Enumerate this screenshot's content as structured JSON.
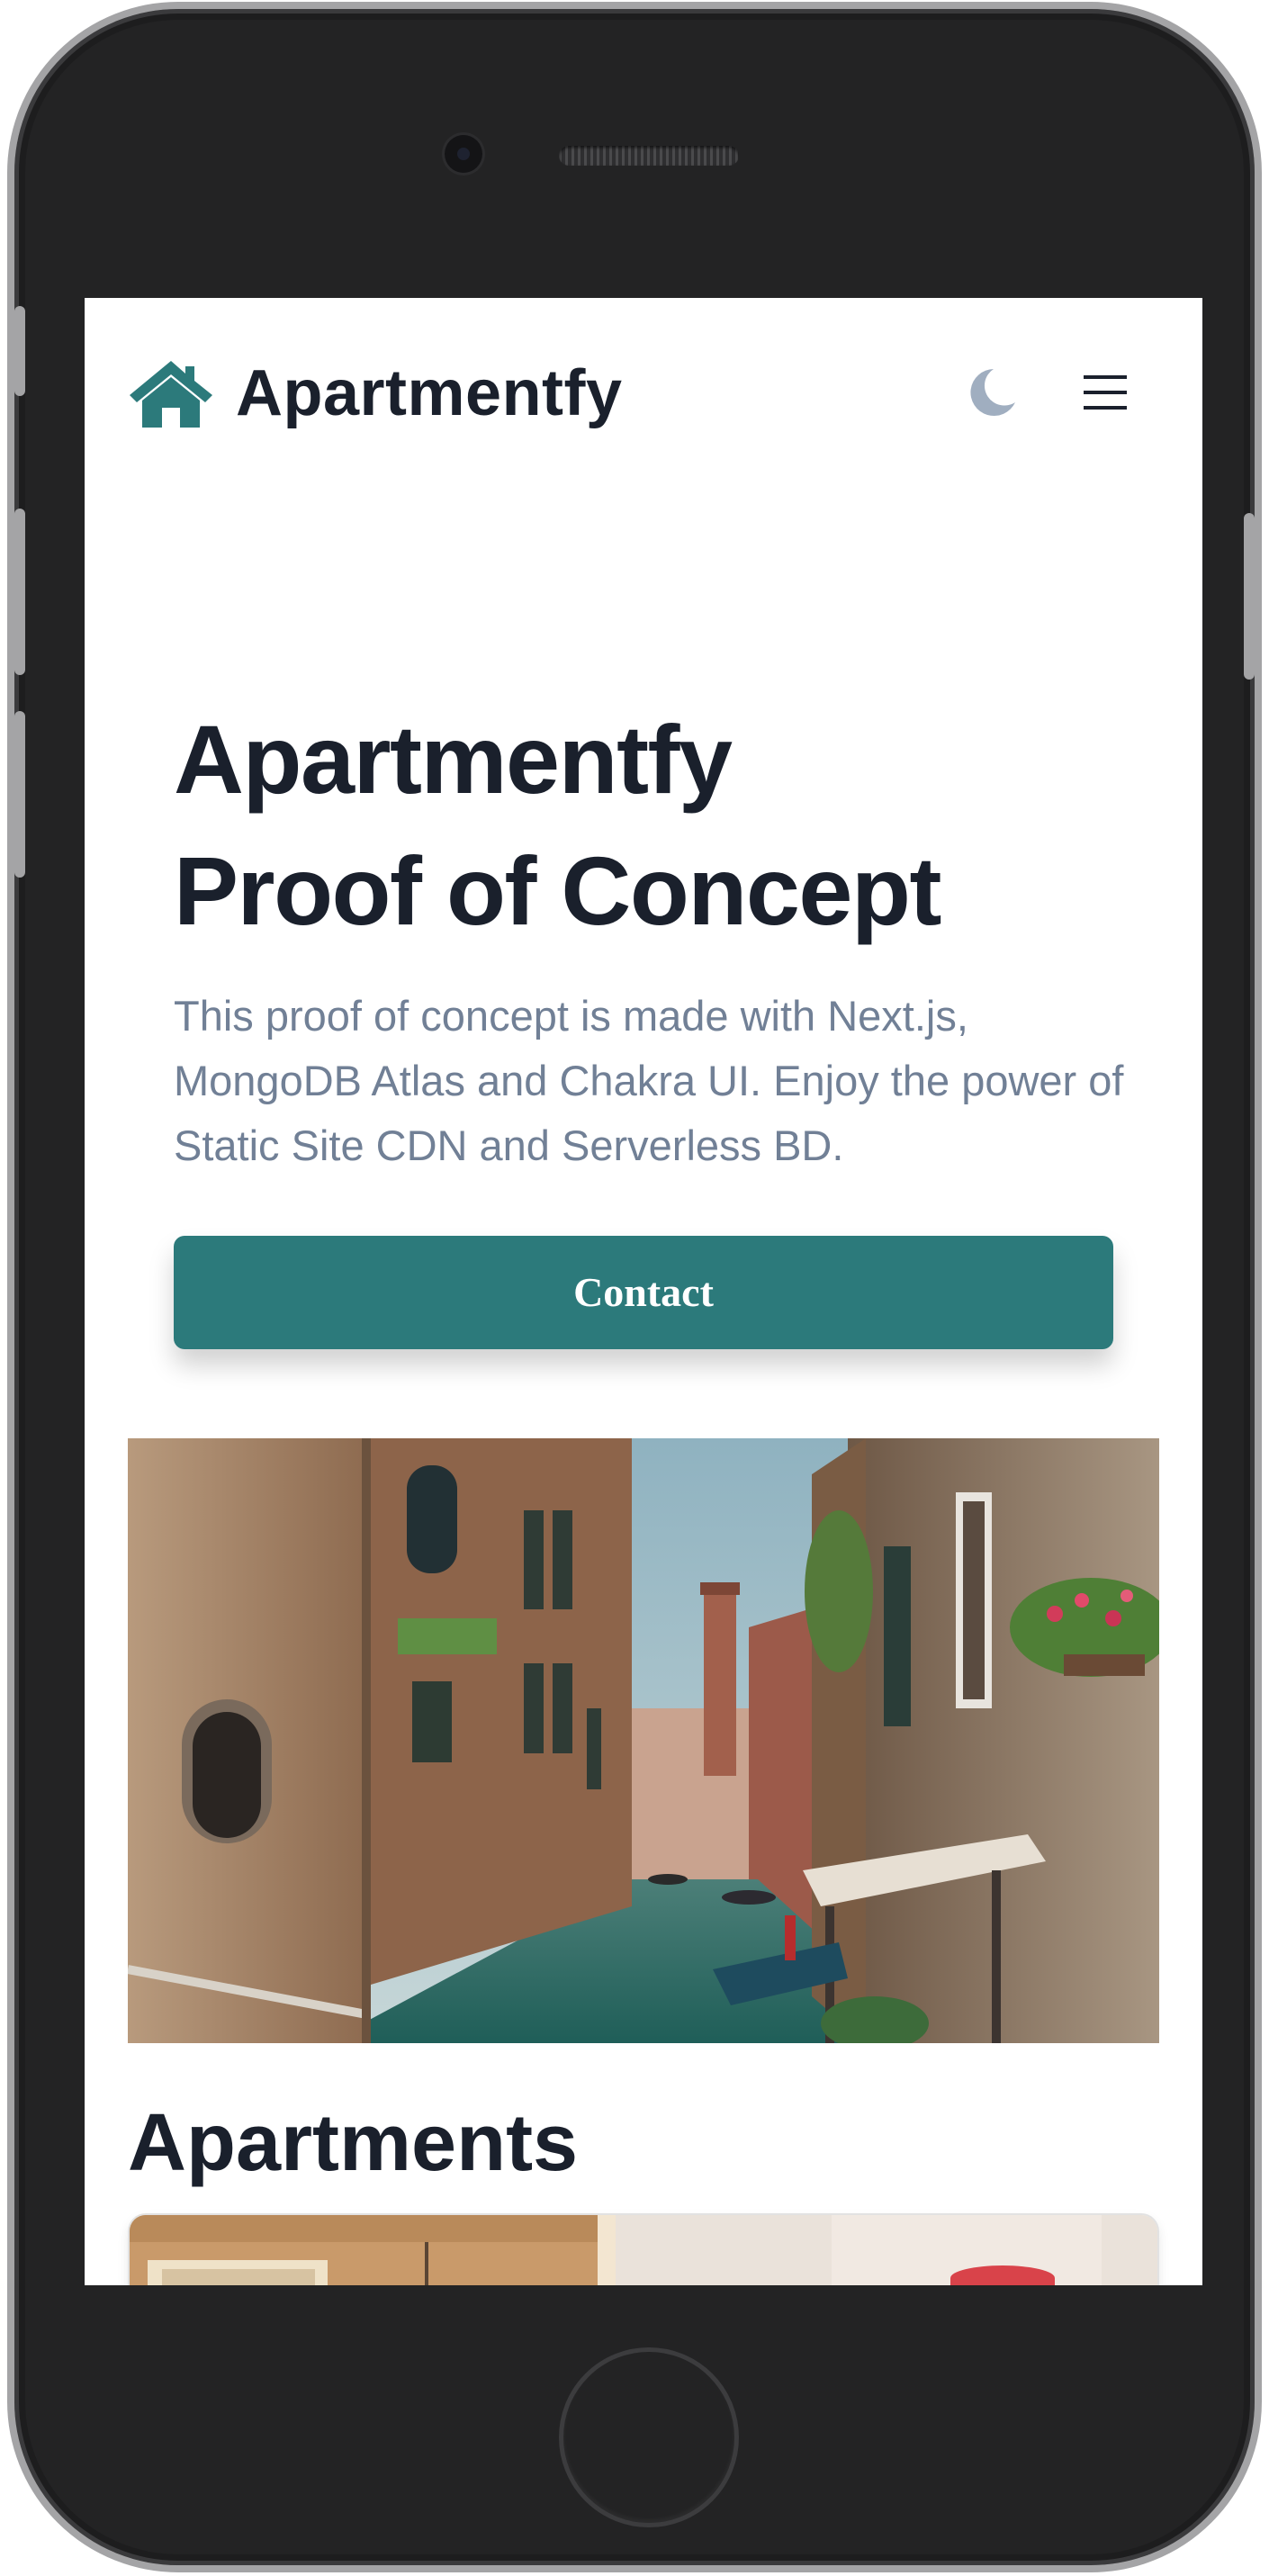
{
  "app": {
    "brand": "Apartmentfy",
    "logo_icon": "home-icon",
    "theme_toggle_icon": "moon-icon",
    "menu_icon": "hamburger-menu-icon"
  },
  "hero": {
    "title_line1": "Apartmentfy",
    "title_line2": "Proof of Concept",
    "description": "This proof of concept is made with Next.js, MongoDB Atlas and Chakra UI. Enjoy the power of Static Site CDN and Serverless BD.",
    "contact_label": "Contact"
  },
  "apartments": {
    "heading": "Apartments"
  },
  "colors": {
    "accent": "#2C7A7B",
    "heading": "#1A202C",
    "body_text": "#718096",
    "moon": "#A0AEC0"
  }
}
